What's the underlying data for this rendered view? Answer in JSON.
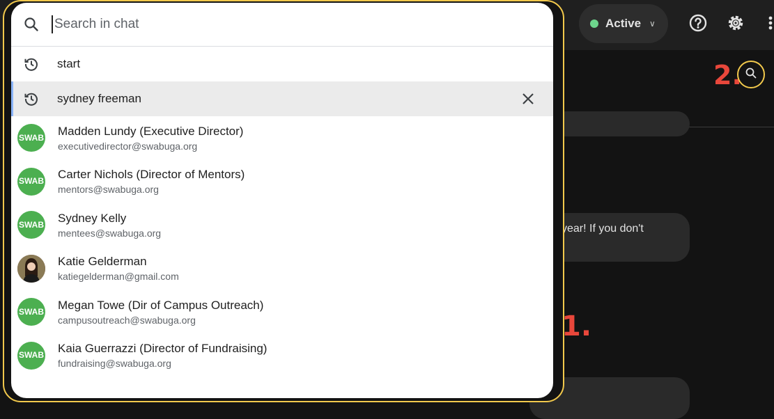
{
  "topbar": {
    "status_label": "Active",
    "help_icon": "help-circle-icon",
    "settings_icon": "gear-icon",
    "apps_icon": "apps-grid-icon"
  },
  "chat": {
    "bubble_text": "is year! If you don't",
    "search_icon": "search-icon"
  },
  "annotations": {
    "one": "1.",
    "two": "2."
  },
  "search": {
    "placeholder": "Search in chat",
    "value": ""
  },
  "history": [
    {
      "label": "start",
      "icon": "history-icon"
    },
    {
      "label": "sydney freeman",
      "icon": "history-icon",
      "selected": true
    }
  ],
  "contacts": [
    {
      "name": "Madden Lundy (Executive Director)",
      "email": "executivedirector@swabuga.org",
      "avatar": "SWAB"
    },
    {
      "name": "Carter Nichols (Director of Mentors)",
      "email": "mentors@swabuga.org",
      "avatar": "SWAB"
    },
    {
      "name": "Sydney Kelly",
      "email": "mentees@swabuga.org",
      "avatar": "SWAB"
    },
    {
      "name": "Katie Gelderman",
      "email": "katiegelderman@gmail.com",
      "avatar": "photo"
    },
    {
      "name": "Megan Towe (Dir of Campus Outreach)",
      "email": "campusoutreach@swabuga.org",
      "avatar": "SWAB"
    },
    {
      "name": "Kaia Guerrazzi (Director of Fundraising)",
      "email": "fundraising@swabuga.org",
      "avatar": "SWAB"
    }
  ],
  "colors": {
    "accent_green": "#4caf50",
    "status_green": "#6dd58c",
    "highlight_yellow": "#f2c94c",
    "annotation_red": "#e8473b"
  }
}
